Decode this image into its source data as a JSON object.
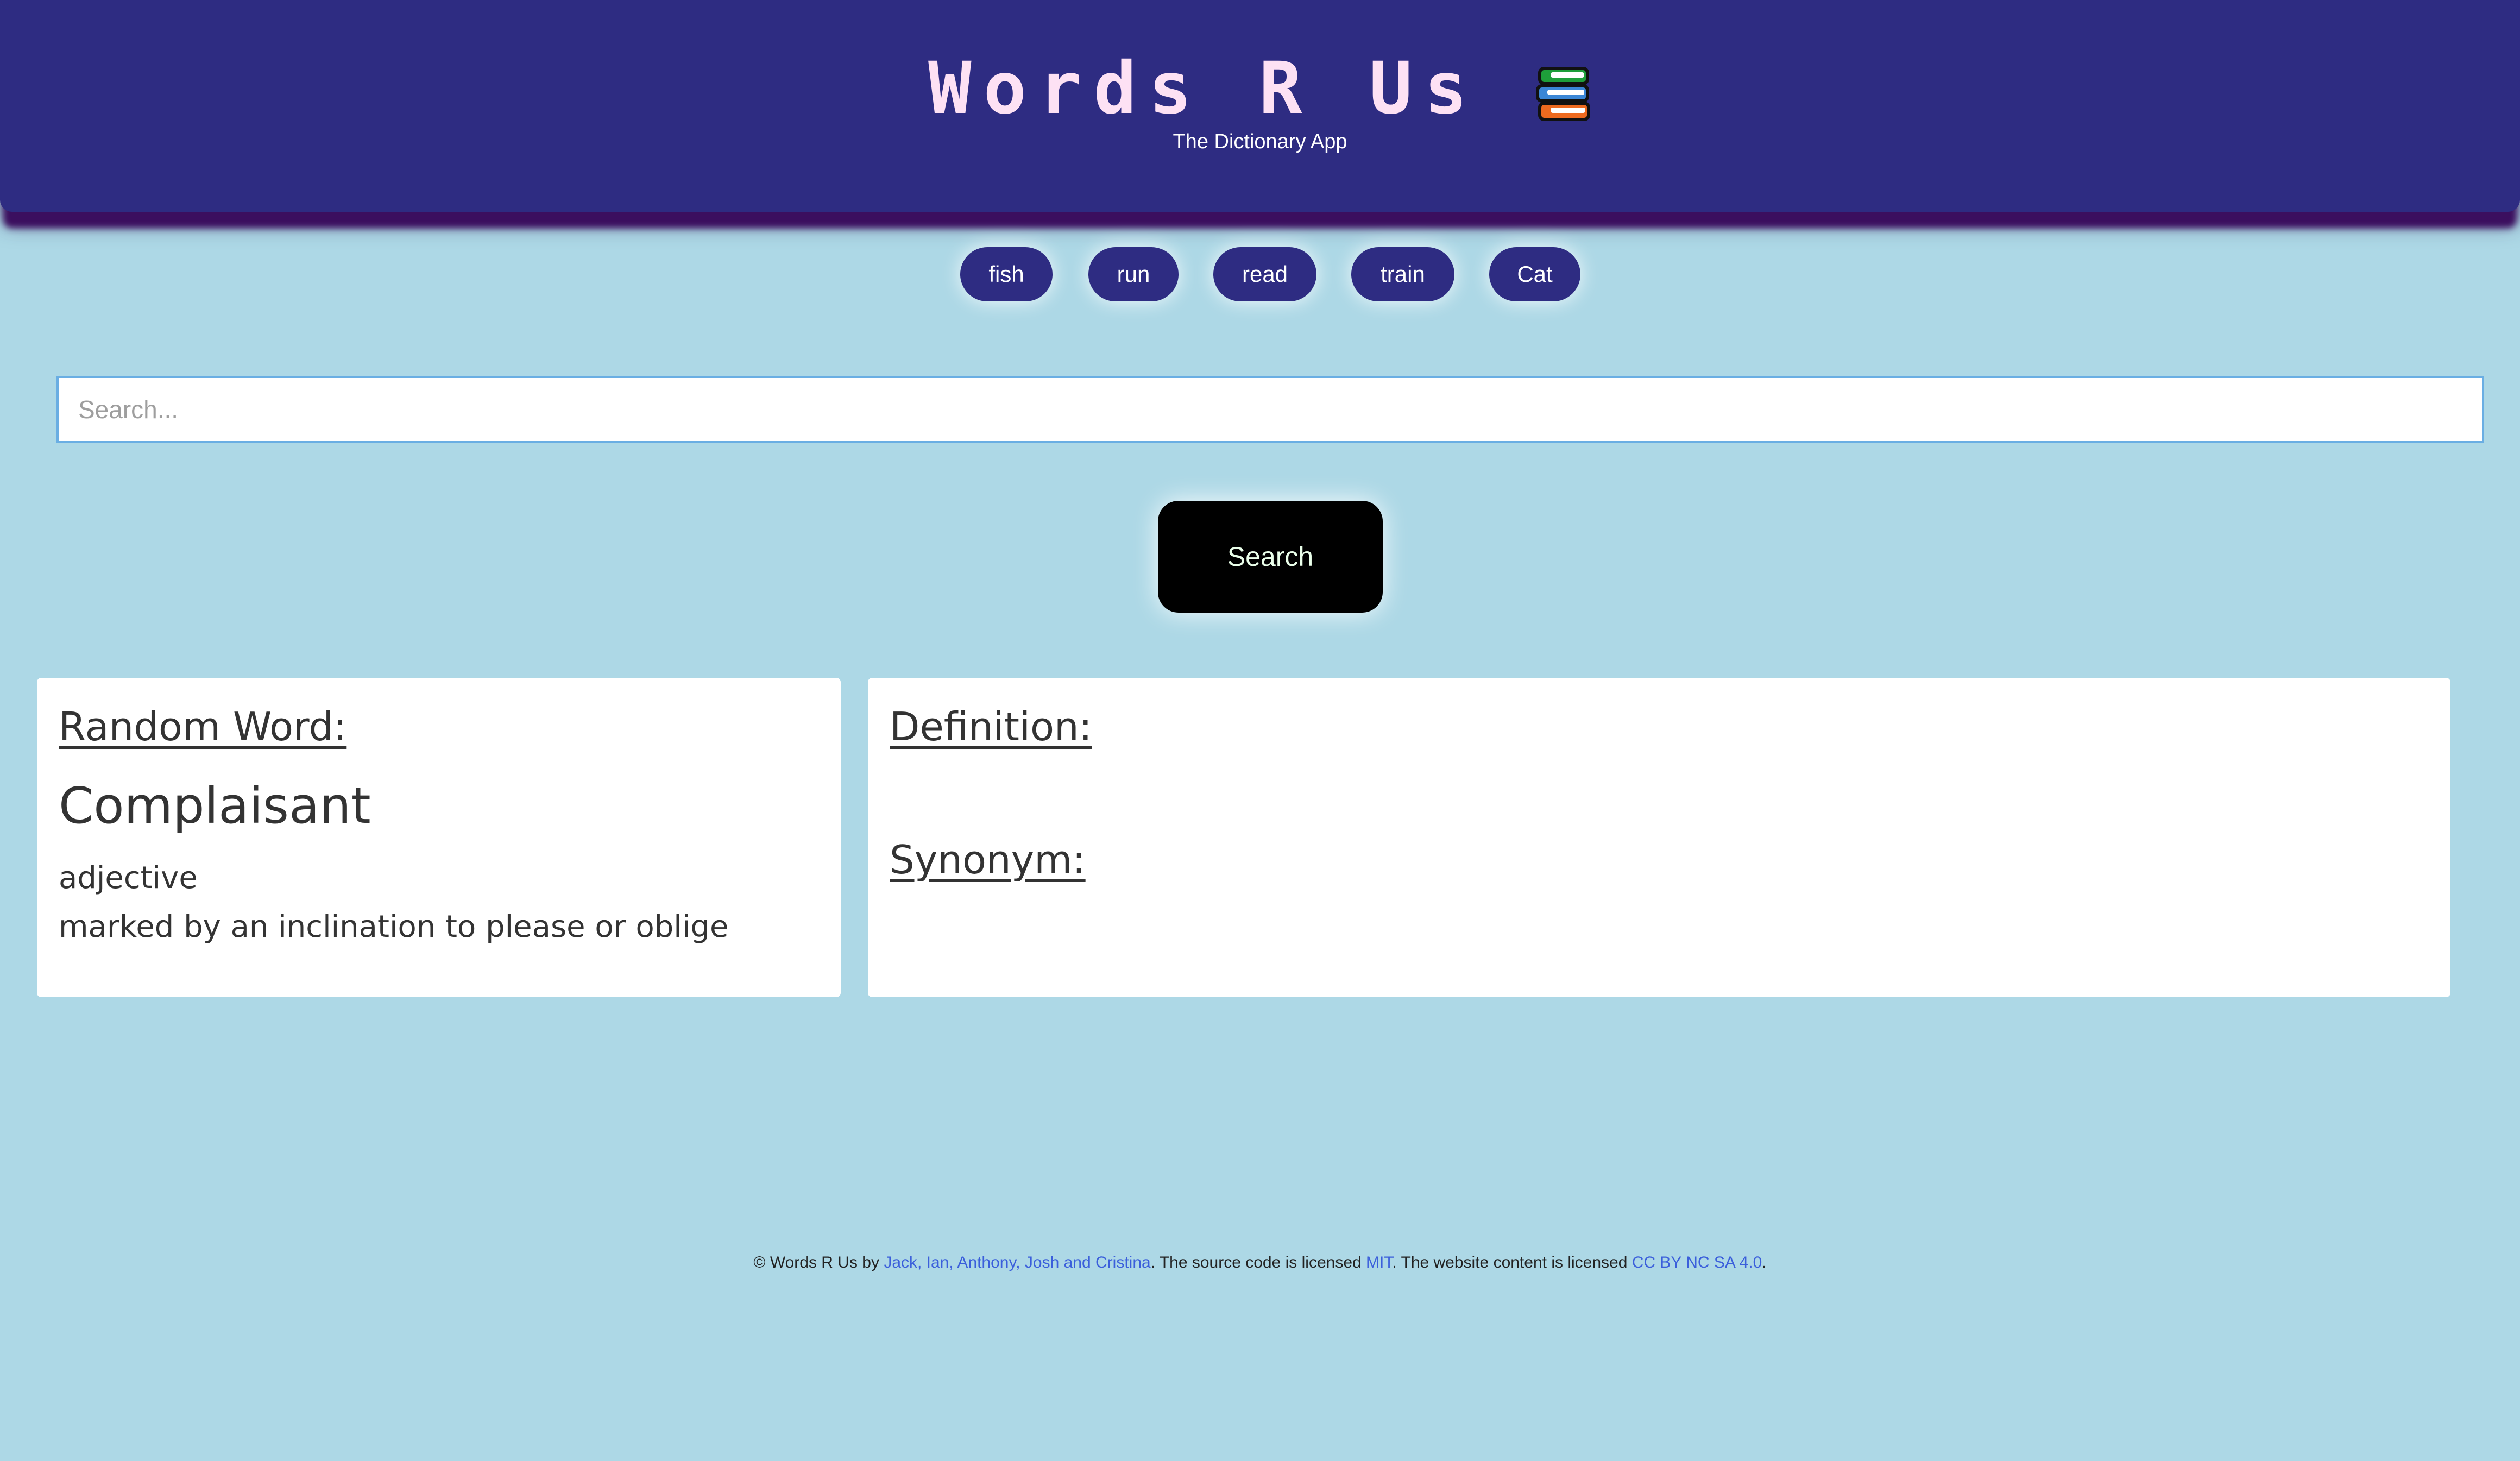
{
  "header": {
    "title": "Words R Us",
    "subtitle": "The Dictionary App",
    "logo_icon": "book-stack-icon"
  },
  "suggestions": [
    "fish",
    "run",
    "read",
    "train",
    "Cat"
  ],
  "search": {
    "placeholder": "Search...",
    "value": "",
    "button_label": "Search"
  },
  "random_word": {
    "heading": "Random Word:",
    "word": "Complaisant",
    "part_of_speech": "adjective",
    "definition": "marked by an inclination to please or oblige"
  },
  "lookup": {
    "definition_heading": "Definition:",
    "definition_text": "",
    "synonym_heading": "Synonym:",
    "synonym_text": ""
  },
  "footer": {
    "prefix": "© Words R Us by ",
    "authors_link": "Jack, Ian, Anthony, Josh and Cristina",
    "source_text": ". The source code is licensed ",
    "source_license_link": "MIT",
    "content_text": ". The website content is licensed ",
    "content_license_link": "CC BY NC SA 4.0",
    "suffix": "."
  },
  "colors": {
    "page_background": "#add8e6",
    "header_background": "#2e2c82",
    "header_shadow": "#3b0f5f",
    "title_color": "#fde1f4",
    "pill_background": "#2e2c82",
    "search_button_background": "#000000",
    "link_color": "#3b5fdb"
  }
}
